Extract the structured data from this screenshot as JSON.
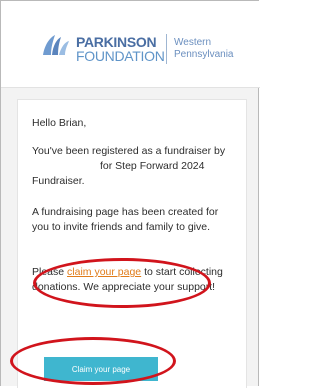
{
  "header": {
    "logo_line1": "PARKINSON",
    "logo_line2": "FOUNDATION",
    "logo_region_line1": "Western",
    "logo_region_line2": "Pennsylvania"
  },
  "email": {
    "greeting": "Hello Brian,",
    "registered_text_a": "You've been registered as a fundraiser by",
    "registered_text_b": "for Step Forward 2024 Fundraiser.",
    "page_created_text": "A fundraising page has been created for you to invite friends and family to give.",
    "claim_prefix": "Please ",
    "claim_link": "claim your page",
    "claim_suffix": " to start collecting donations. We appreciate your support!",
    "button_label": "Claim your page"
  },
  "colors": {
    "brand_blue": "#4a6ea3",
    "link_orange": "#e07c1a",
    "button_teal": "#3fb6cf",
    "annotation_red": "#d1141c"
  }
}
